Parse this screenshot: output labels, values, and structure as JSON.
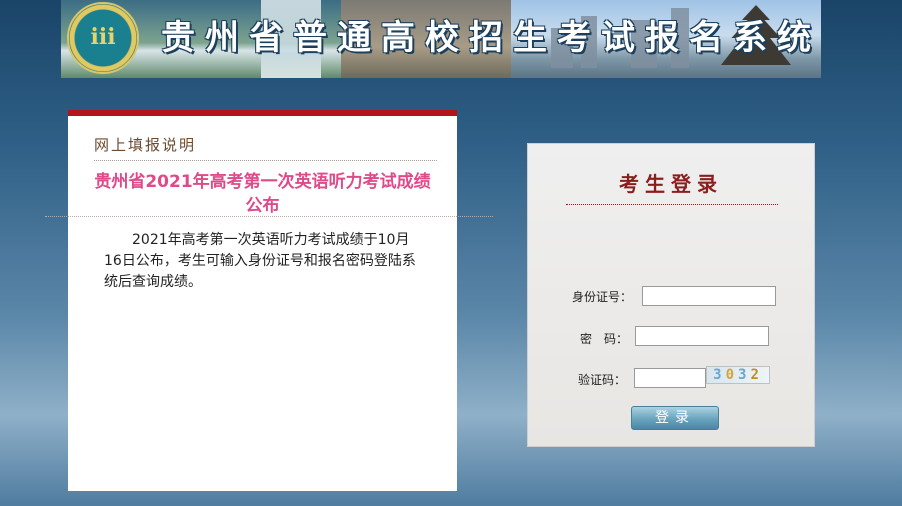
{
  "banner": {
    "title": "贵州省普通高校招生考试报名系统"
  },
  "notice": {
    "heading": "网上填报说明",
    "title": "贵州省2021年高考第一次英语听力考试成绩公布",
    "body": "2021年高考第一次英语听力考试成绩于10月16日公布，考生可输入身份证号和报名密码登陆系统后查询成绩。"
  },
  "login": {
    "title": "考生登录",
    "id_label": "身份证号：",
    "id_value": "",
    "password_label": "密　码：",
    "password_value": "",
    "captcha_label": "验证码：",
    "captcha_value": "",
    "captcha_text": [
      "3",
      "0",
      "3",
      "2"
    ],
    "submit_label": "登录"
  },
  "colors": {
    "accent_red": "#b3141b",
    "notice_title": "#e04a8a",
    "login_title": "#8a1d1d"
  }
}
